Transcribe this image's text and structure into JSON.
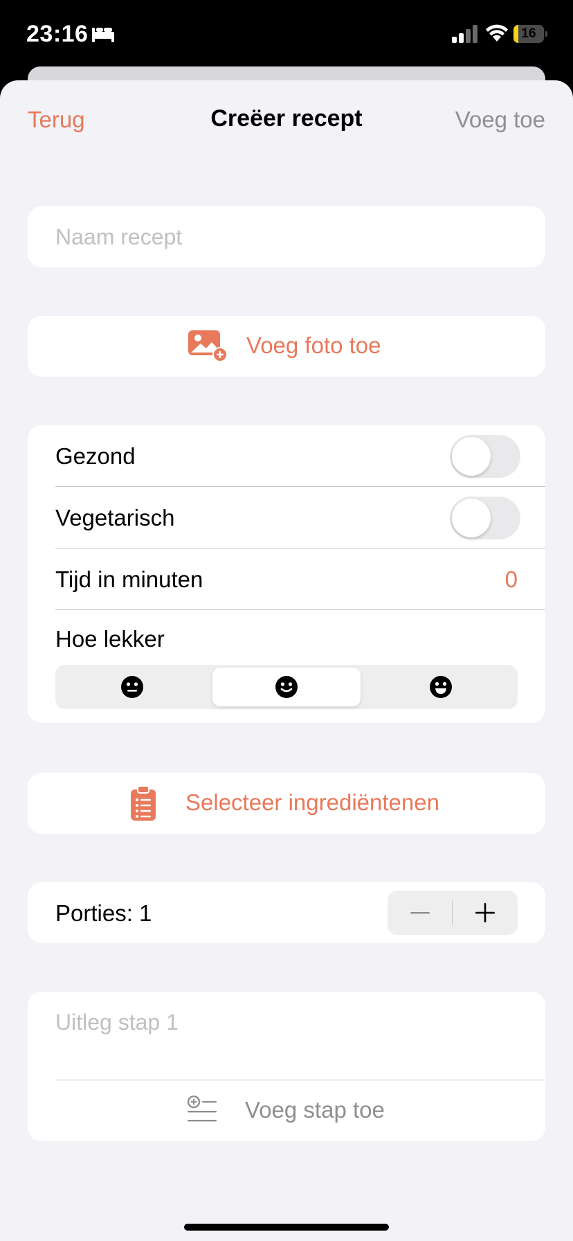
{
  "status_bar": {
    "time": "23:16",
    "battery": "16",
    "battery_level_percent": 16,
    "icons": [
      "bed-icon",
      "cellular-signal-icon",
      "wifi-icon",
      "battery-icon"
    ]
  },
  "nav": {
    "back_label": "Terug",
    "title": "Creëer recept",
    "add_label": "Voeg toe"
  },
  "recipe_name": {
    "placeholder": "Naam recept",
    "value": ""
  },
  "add_photo": {
    "label": "Voeg foto toe",
    "icon": "add-photo-icon"
  },
  "options": {
    "healthy": {
      "label": "Gezond",
      "on": false
    },
    "vegetarian": {
      "label": "Vegetarisch",
      "on": false
    },
    "time": {
      "label": "Tijd in minuten",
      "value": "0"
    },
    "taste": {
      "label": "Hoe lekker",
      "segments": [
        "neutral-face-icon",
        "smiling-face-icon",
        "grinning-face-icon"
      ],
      "selected_index": 1
    }
  },
  "ingredients": {
    "label": "Selecteer ingrediëntenen",
    "icon": "clipboard-list-icon"
  },
  "portions": {
    "label": "Porties: 1",
    "value": 1
  },
  "steps": {
    "step_placeholder": "Uitleg stap 1",
    "add_step_label": "Voeg stap toe",
    "add_step_icon": "add-list-item-icon"
  },
  "colors": {
    "accent": "#e8795a",
    "background": "#f2f2f7",
    "secondary_text": "#8e8e93",
    "placeholder": "#c0c0c4"
  }
}
